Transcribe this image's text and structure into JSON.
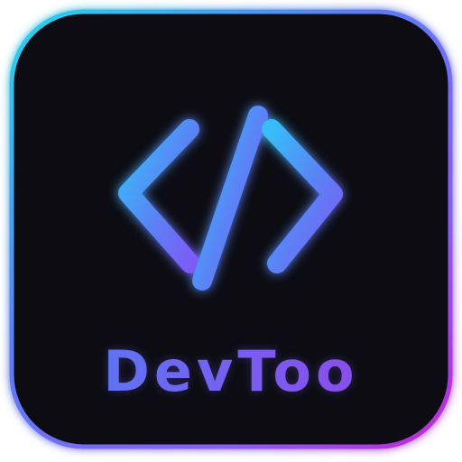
{
  "app": {
    "name": "DevToo",
    "icon_name": "code-brackets-icon"
  },
  "colors": {
    "tile_background": "#0c0c12",
    "border_gradient": [
      "#22d6ee",
      "#5b7cf6",
      "#8b5cf6",
      "#c026d3"
    ],
    "glyph_gradient": [
      "#38bdf8",
      "#5b82f6",
      "#7c5cf6"
    ],
    "label_gradient": [
      "#4c84f2",
      "#7a5cf0",
      "#9a3ee8"
    ]
  }
}
